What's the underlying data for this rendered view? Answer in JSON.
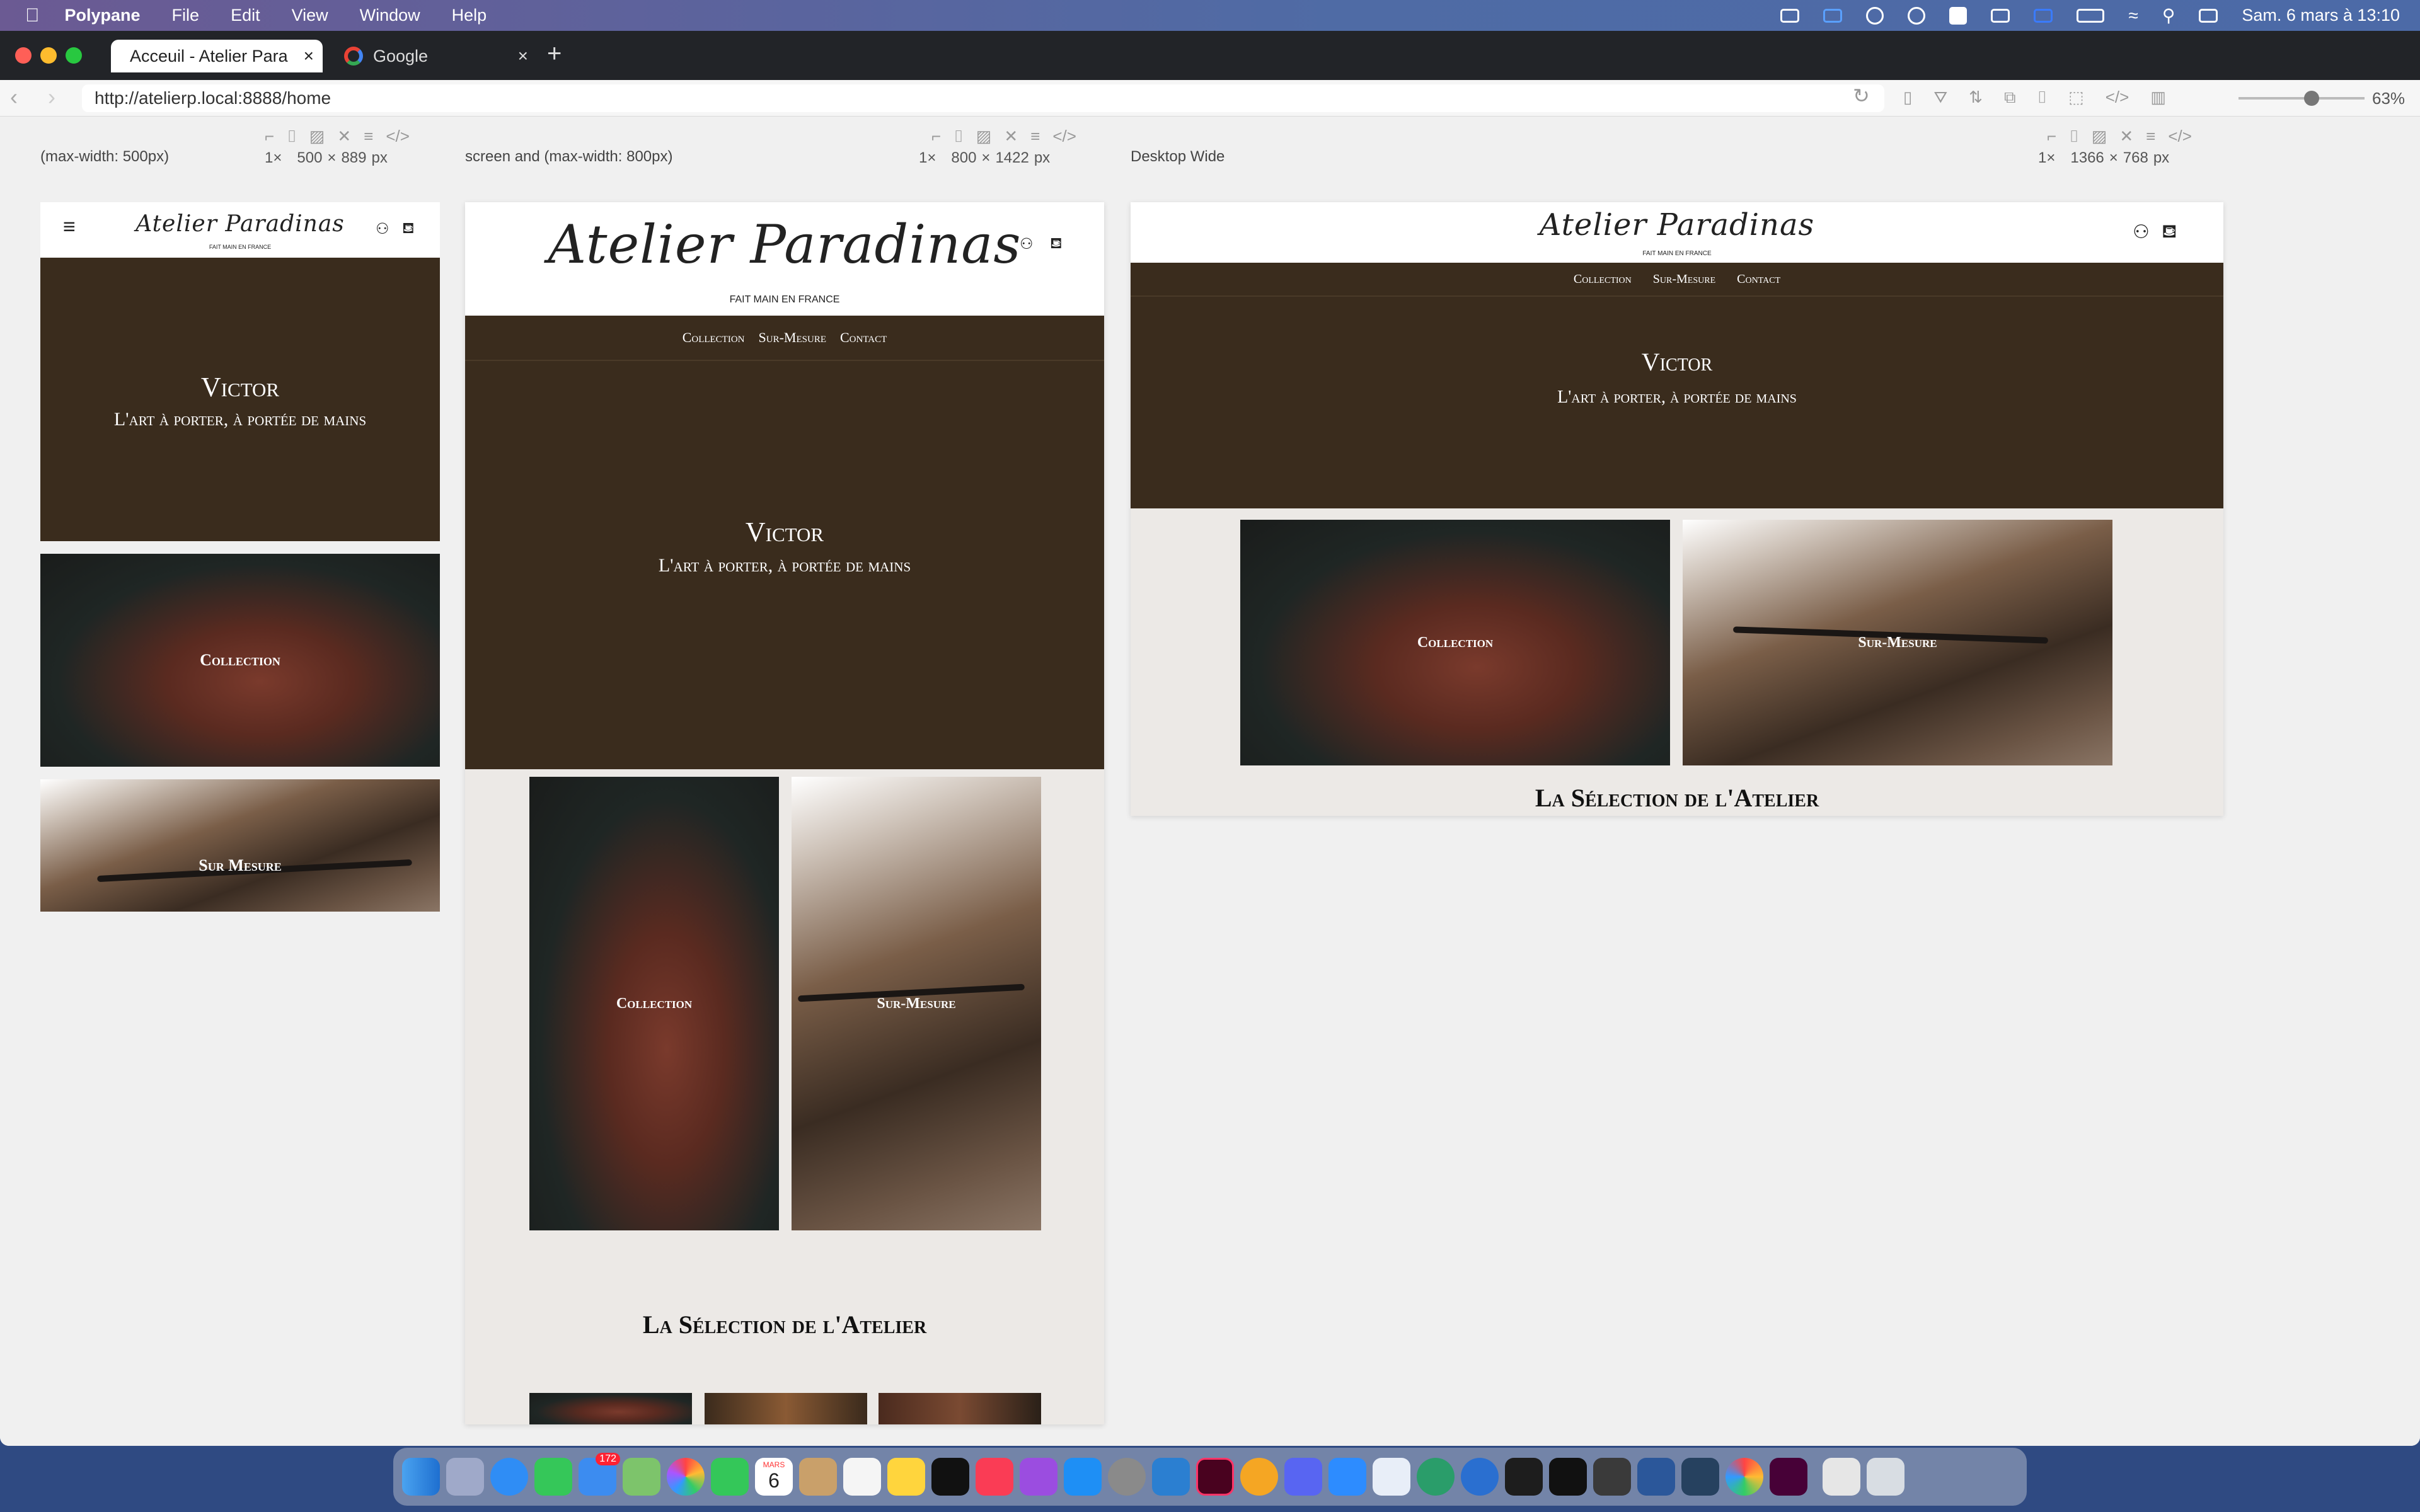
{
  "menubar": {
    "app": "Polypane",
    "items": [
      "File",
      "Edit",
      "View",
      "Window",
      "Help"
    ],
    "clock": "Sam. 6 mars à 13:10"
  },
  "browser": {
    "tabs": [
      {
        "label": "Acceuil - Atelier Para",
        "active": true
      },
      {
        "label": "Google",
        "active": false
      }
    ],
    "new_tab": "+",
    "url": "http://atelierp.local:8888/home",
    "zoom": "63%"
  },
  "panes": [
    {
      "label": "(max-width: 500px)",
      "scale": "1×",
      "width": "500",
      "height": "889",
      "unit": "px"
    },
    {
      "label": "screen and (max-width: 800px)",
      "scale": "1×",
      "width": "800",
      "height": "1422",
      "unit": "px"
    },
    {
      "label": "Desktop Wide",
      "scale": "1×",
      "width": "1366",
      "height": "768",
      "unit": "px"
    }
  ],
  "site": {
    "logo": "Atelier Paradinas",
    "tagline": "FAIT MAIN EN FRANCE",
    "nav": [
      "Collection",
      "Sur-Mesure",
      "Contact"
    ],
    "hero_title": "Victor",
    "hero_subtitle": "L'art à porter, à portée de mains",
    "tile_collection": "Collection",
    "tile_sur_mesure": "Sur-Mesure",
    "tile_sur_mesure_mobile": "Sur Mesure",
    "selection_title": "La Sélection de l'Atelier"
  },
  "dock": {
    "calendar_month": "MARS",
    "calendar_day": "6",
    "mail_badge": "172"
  },
  "colors": {
    "hero_brown": "#3a2c1d",
    "page_beige": "#ece9e6"
  }
}
